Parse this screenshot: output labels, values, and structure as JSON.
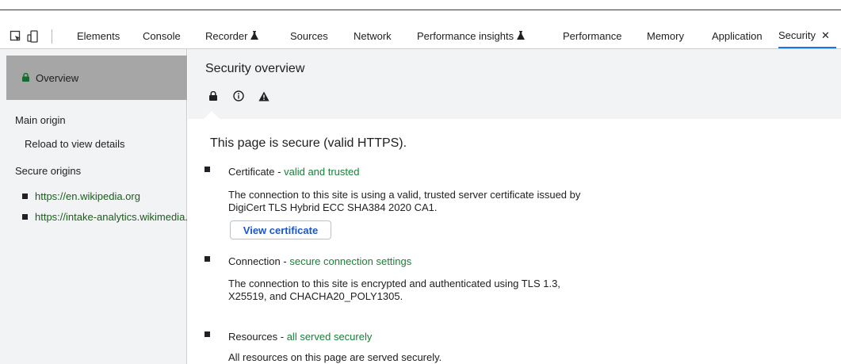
{
  "toolbar": {
    "icons": [
      "inspect-element-icon",
      "device-toolbar-icon"
    ],
    "tabs": [
      {
        "label": "Elements"
      },
      {
        "label": "Console"
      },
      {
        "label": "Recorder"
      },
      {
        "label": "Sources"
      },
      {
        "label": "Network"
      },
      {
        "label": "Performance insights"
      },
      {
        "label": "Performance"
      },
      {
        "label": "Memory"
      },
      {
        "label": "Application"
      },
      {
        "label": "Security"
      }
    ],
    "active_tab": "Security",
    "experimental_icon": "beaker-icon"
  },
  "sidebar": {
    "overview_label": "Overview",
    "main_origin_heading": "Main origin",
    "main_origin_value": "Reload to view details",
    "secure_origins_heading": "Secure origins",
    "secure_origins": [
      "https://en.wikipedia.org",
      "https://intake-analytics.wikimedia.org"
    ]
  },
  "main": {
    "title": "Security overview",
    "legend_icons": [
      "lock-icon",
      "info-icon",
      "warning-icon"
    ],
    "summary": "This page is secure (valid HTTPS).",
    "items": [
      {
        "title": "Certificate",
        "status": "valid and trusted",
        "description": "The connection to this site is using a valid, trusted server certificate issued by DigiCert TLS Hybrid ECC SHA384 2020 CA1.",
        "button": "View certificate"
      },
      {
        "title": "Connection",
        "status": "secure connection settings",
        "description": "The connection to this site is encrypted and authenticated using TLS 1.3, X25519, and CHACHA20_POLY1305."
      },
      {
        "title": "Resources",
        "status": "all served securely",
        "description": "All resources on this page are served securely."
      }
    ],
    "separator": " - "
  },
  "colors": {
    "accent": "#1a73e8",
    "secure_text": "#188038",
    "sidebar_bg": "#f1f3f4",
    "selected_bg": "#a6a6a6"
  }
}
